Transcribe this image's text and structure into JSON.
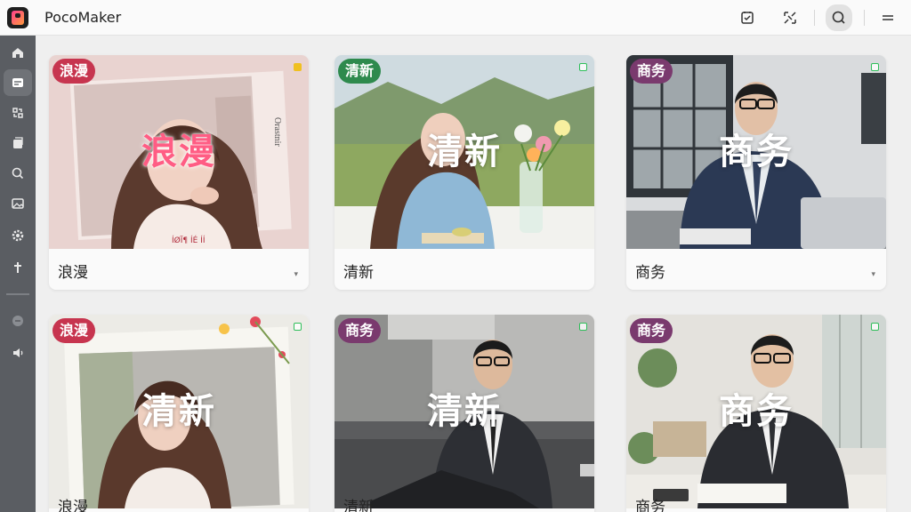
{
  "app": {
    "title": "PocoMaker"
  },
  "cards": [
    {
      "tag": "浪漫",
      "overlay": "浪漫",
      "caption": "浪漫"
    },
    {
      "tag": "清新",
      "overlay": "清新",
      "caption": "清新"
    },
    {
      "tag": "商务",
      "overlay": "商务",
      "caption": "商务"
    },
    {
      "tag": "浪漫",
      "overlay": "清新",
      "caption": "浪漫"
    },
    {
      "tag": "商务",
      "overlay": "清新",
      "caption": "清新"
    },
    {
      "tag": "商务",
      "overlay": "商务",
      "caption": "商务"
    }
  ],
  "card1_photo_text": "Orastnir",
  "card1_bottom_text": "ÍØÏ¶ ÍÉ ÍÍ",
  "colors": {
    "sidebar": "#5a5d62",
    "tag_romance": "#c7354f",
    "tag_fresh": "#2e8a4d",
    "tag_business": "#7a3a6e"
  }
}
